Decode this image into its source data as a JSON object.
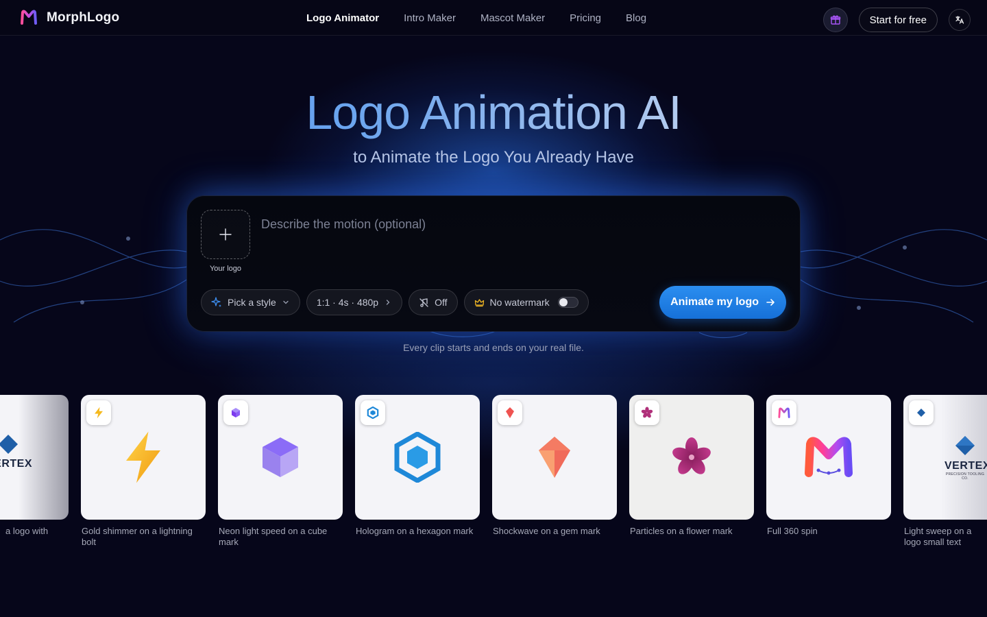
{
  "brand": {
    "name": "MorphLogo",
    "icon": "m-logo-icon"
  },
  "nav": {
    "links": [
      {
        "label": "Logo Animator",
        "active": true
      },
      {
        "label": "Intro Maker",
        "active": false
      },
      {
        "label": "Mascot Maker",
        "active": false
      },
      {
        "label": "Pricing",
        "active": false
      },
      {
        "label": "Blog",
        "active": false
      }
    ],
    "gift_icon": "gift-icon",
    "start_label": "Start for free",
    "language_icon": "translate-icon"
  },
  "hero": {
    "title": "Logo Animation AI",
    "subtitle": "to Animate the Logo You Already Have"
  },
  "prompt": {
    "upload_label": "Your logo",
    "placeholder": "Describe the motion (optional)",
    "value": "",
    "style_label": "Pick a style",
    "settings_label": "1:1 · 4s · 480p",
    "audio_label": "Off",
    "watermark_label": "No watermark",
    "watermark_enabled": false,
    "submit_label": "Animate my logo"
  },
  "note": "Every clip starts and ends on your real file.",
  "gallery": [
    {
      "caption": "a logo with",
      "type": "vertex-partial"
    },
    {
      "caption": "Gold shimmer on a lightning bolt",
      "type": "bolt"
    },
    {
      "caption": "Neon light speed on a cube mark",
      "type": "cube"
    },
    {
      "caption": "Hologram on a hexagon mark",
      "type": "hexagon"
    },
    {
      "caption": "Shockwave on a gem mark",
      "type": "gem"
    },
    {
      "caption": "Particles on a flower mark",
      "type": "flower"
    },
    {
      "caption": "Full 360 spin",
      "type": "m-logo"
    },
    {
      "caption": "Light sweep on a logo small text",
      "type": "vertex"
    }
  ],
  "vertex_logo": {
    "word": "VERTEX",
    "tagline": "PRECISION TOOLING CO."
  },
  "colors": {
    "background": "#06061a",
    "accent_blue": "#1f80e6",
    "bolt": "#f5b91e",
    "cube": "#8b5cf6",
    "hexagon": "#1e88d8",
    "gem": "#ef5350",
    "flower": "#b0307a"
  }
}
